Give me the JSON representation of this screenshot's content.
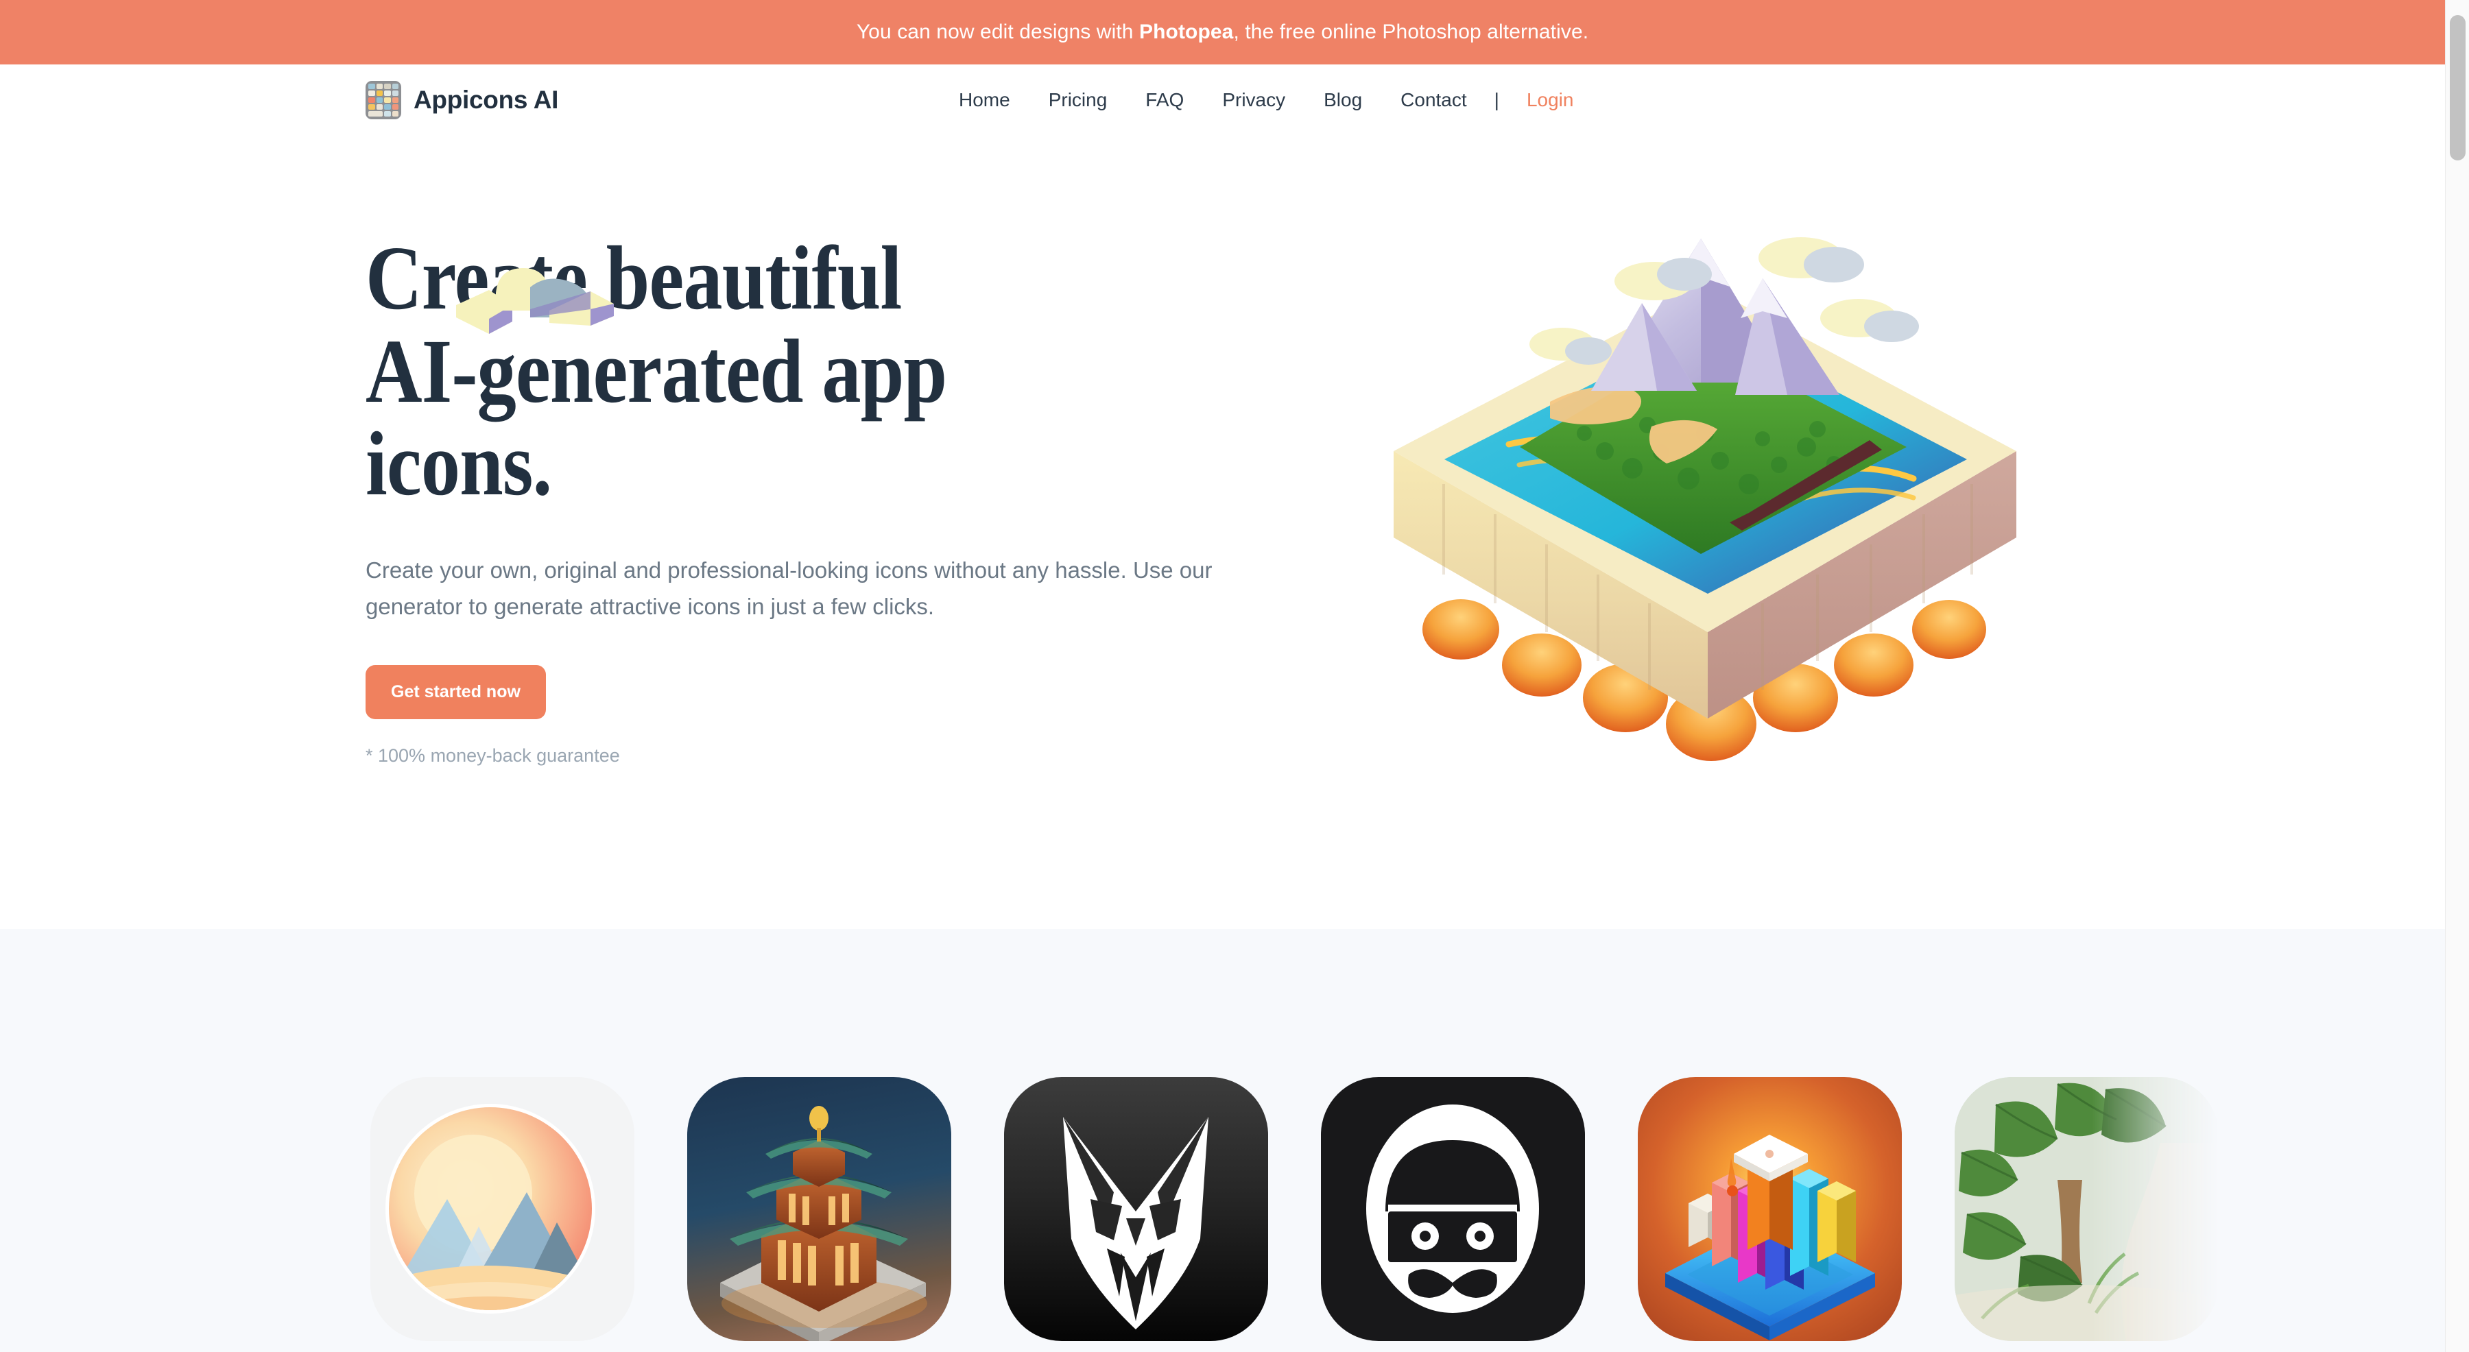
{
  "promo": {
    "text_before": "You can now edit designs with ",
    "highlight": "Photopea",
    "text_after": ", the free online Photoshop alternative.",
    "background": "#ef8266",
    "text_color": "#ffffff"
  },
  "header": {
    "brand_name": "Appicons AI",
    "logo_icon": "app-grid-icon",
    "nav": [
      {
        "label": "Home",
        "name": "nav-link-home"
      },
      {
        "label": "Pricing",
        "name": "nav-link-pricing"
      },
      {
        "label": "FAQ",
        "name": "nav-link-faq"
      },
      {
        "label": "Privacy",
        "name": "nav-link-privacy"
      },
      {
        "label": "Blog",
        "name": "nav-link-blog"
      },
      {
        "label": "Contact",
        "name": "nav-link-contact"
      }
    ],
    "separator": "|",
    "login_label": "Login",
    "login_color": "#f0825f"
  },
  "hero": {
    "title": "Create beautiful\nAI-generated app\nicons.",
    "title_color": "#22303f",
    "subtitle": "Create your own, original and professional-looking icons without any hassle. Use our generator to generate attractive icons in just a few clicks.",
    "subtitle_color": "#6b7885",
    "cta_label": "Get started now",
    "cta_color": "#f0815e",
    "guarantee": "* 100% money-back guarantee",
    "guarantee_color": "#9aa6b2",
    "illustration": "isometric-volcano-island-illustration",
    "cloud": "isometric-cloud-illustration"
  },
  "showcase": {
    "background": "#f7f9fc",
    "icons": [
      {
        "name": "icon-card-sunset-mountains",
        "alt": "sunset mountains circle icon"
      },
      {
        "name": "icon-card-pagoda",
        "alt": "green roofed pagoda temple icon"
      },
      {
        "name": "icon-card-fox",
        "alt": "white fox head on black icon"
      },
      {
        "name": "icon-card-bandit",
        "alt": "masked bandit with mustache icon"
      },
      {
        "name": "icon-card-bar-chart-city",
        "alt": "colorful isometric bar chart icon"
      },
      {
        "name": "icon-card-jungle",
        "alt": "jungle rainforest path icon"
      }
    ]
  },
  "scrollbar": {
    "name": "page-scrollbar"
  }
}
